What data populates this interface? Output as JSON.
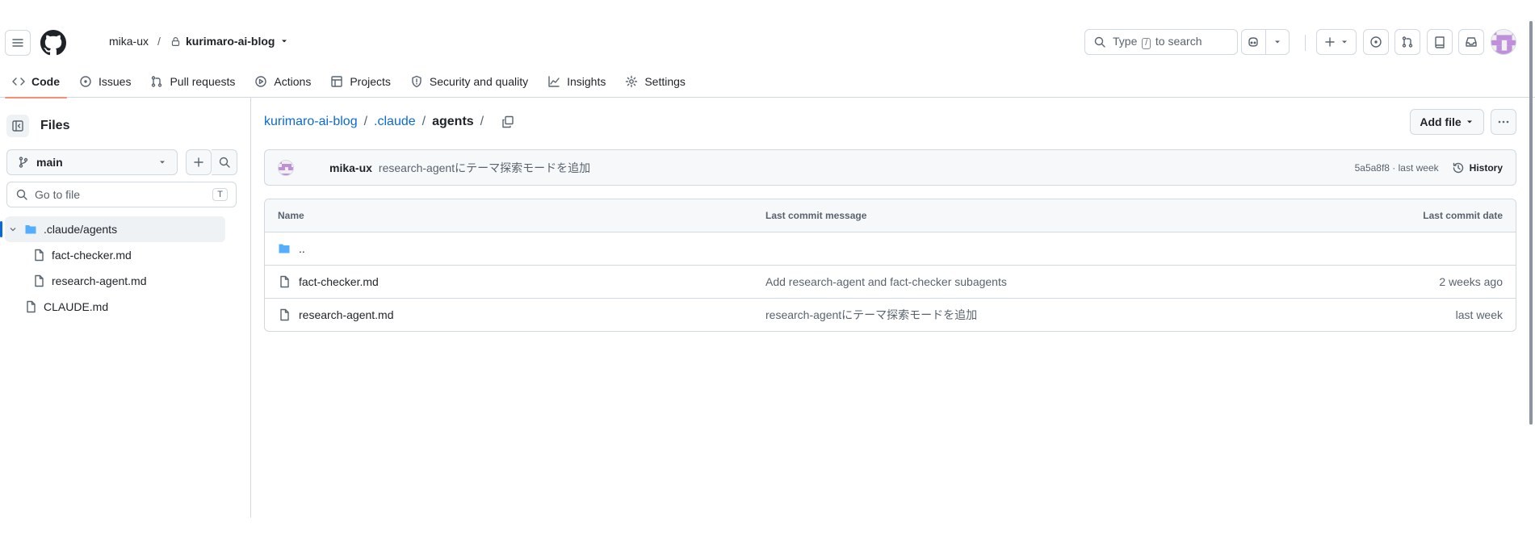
{
  "header": {
    "owner": "mika-ux",
    "separator": "/",
    "repo": "kurimaro-ai-blog",
    "search_prefix": "Type",
    "search_key": "/",
    "search_suffix": "to search"
  },
  "tabs": [
    {
      "label": "Code",
      "icon": "code-icon",
      "active": true
    },
    {
      "label": "Issues",
      "icon": "issue-icon"
    },
    {
      "label": "Pull requests",
      "icon": "pull-request-icon"
    },
    {
      "label": "Actions",
      "icon": "play-icon"
    },
    {
      "label": "Projects",
      "icon": "table-icon"
    },
    {
      "label": "Security and quality",
      "icon": "shield-icon"
    },
    {
      "label": "Insights",
      "icon": "graph-icon"
    },
    {
      "label": "Settings",
      "icon": "gear-icon"
    }
  ],
  "sidebar": {
    "title": "Files",
    "branch": "main",
    "goto_placeholder": "Go to file",
    "goto_key": "T",
    "tree": [
      {
        "label": ".claude/agents",
        "type": "folder",
        "selected": true
      },
      {
        "label": "fact-checker.md",
        "type": "file"
      },
      {
        "label": "research-agent.md",
        "type": "file"
      },
      {
        "label": "CLAUDE.md",
        "type": "file"
      }
    ]
  },
  "breadcrumb": {
    "root": "kurimaro-ai-blog",
    "mid": ".claude",
    "current": "agents",
    "sep": "/"
  },
  "actions": {
    "add_file": "Add file"
  },
  "latest_commit": {
    "author": "mika-ux",
    "message": "research-agentにテーマ探索モードを追加",
    "meta": "5a5a8f8 · last week",
    "history_label": "History"
  },
  "table": {
    "headers": {
      "name": "Name",
      "message": "Last commit message",
      "date": "Last commit date"
    },
    "parent": "..",
    "rows": [
      {
        "name": "fact-checker.md",
        "message": "Add research-agent and fact-checker subagents",
        "date": "2 weeks ago"
      },
      {
        "name": "research-agent.md",
        "message": "research-agentにテーマ探索モードを追加",
        "date": "last week"
      }
    ]
  },
  "colors": {
    "link": "#0969da",
    "tab_underline": "#fd8c73",
    "folder": "#54aeff",
    "avatar": "#bf8fdc"
  }
}
